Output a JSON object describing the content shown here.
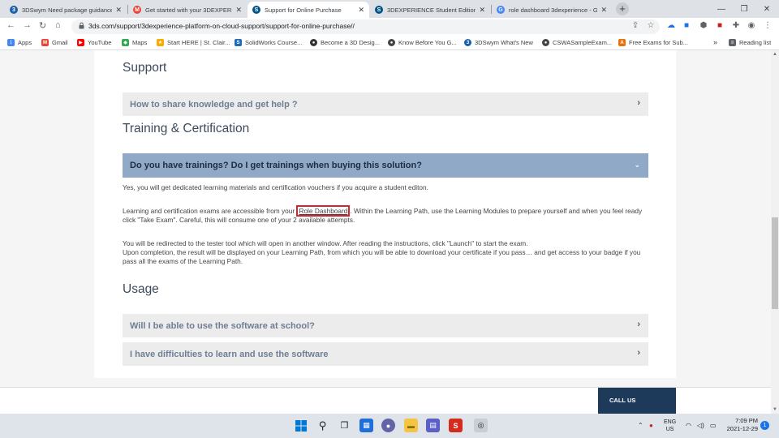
{
  "browser": {
    "tabs": [
      {
        "title": "3DSwym Need package guidance",
        "fav_color": "#1b5fa8",
        "fav_glyph": "3"
      },
      {
        "title": "Get started with your 3DEXPERIE",
        "fav_color": "#ea4335",
        "fav_glyph": "M"
      },
      {
        "title": "Support for Online Purchase",
        "fav_color": "#005386",
        "fav_glyph": "S"
      },
      {
        "title": "3DEXPERIENCE Student Editions",
        "fav_color": "#005386",
        "fav_glyph": "S"
      },
      {
        "title": "role dashboard 3dexperience - G",
        "fav_color": "#4285f4",
        "fav_glyph": "G"
      }
    ],
    "active_tab": 2,
    "new_tab": "+",
    "window_controls": {
      "minimize": "—",
      "restore": "❐",
      "close": "✕"
    },
    "url": "3ds.com/support/3dexperience-platform-on-cloud-support/support-for-online-purchase//",
    "bookmarks": [
      {
        "label": "Apps",
        "color": "#4285f4",
        "glyph": "⋮"
      },
      {
        "label": "Gmail",
        "color": "#ea4335",
        "glyph": "M"
      },
      {
        "label": "YouTube",
        "color": "#ff0000",
        "glyph": "▶"
      },
      {
        "label": "Maps",
        "color": "#34a853",
        "glyph": "◆"
      },
      {
        "label": "Start HERE | St. Clair...",
        "color": "#f9ab00",
        "glyph": "★"
      },
      {
        "label": "SolidWorks Course...",
        "color": "#1e6bb8",
        "glyph": "S"
      },
      {
        "label": "Become a 3D Desig...",
        "color": "#333333",
        "glyph": "●"
      },
      {
        "label": "Know Before You G...",
        "color": "#444444",
        "glyph": "●"
      },
      {
        "label": "3DSwym What's New",
        "color": "#1b5fa8",
        "glyph": "3"
      },
      {
        "label": "CSWASampleExam...",
        "color": "#444444",
        "glyph": "●"
      },
      {
        "label": "Free Exams for Sub...",
        "color": "#e8710a",
        "glyph": "A"
      }
    ],
    "bookmarks_more": "»",
    "reading_list": "Reading list"
  },
  "content": {
    "support_heading": "Support",
    "support_items": [
      {
        "label": "How to share knowledge and get help ?",
        "chevron": "›"
      }
    ],
    "training_heading": "Training & Certification",
    "training_item": {
      "label": "Do you have trainings? Do I get trainings when buying this solution?",
      "chevron": "⌄"
    },
    "answer": {
      "p1": "Yes, you will get dedicated learning materials and certification vouchers if you acquire a student editon.",
      "p2_before": "Learning and certification exams are accessible from your ",
      "p2_link": "Role Dashboard",
      "p2_after": ". Within the Learning Path, use the Learning Modules to prepare yourself and when you feel ready click \"Take Exam\". Careful, this will consume one of your 2 available attempts.",
      "p3_line1": "You will be redirected to the tester tool which will open in another window. After reading the instructions, click \"Launch\" to start the exam.",
      "p3_line2": "Upon completion, the result will be displayed on your Learning Path, from which you will be able to download your certificate if you pass… and get access to your badge if you pass all the exams of the Learning Path."
    },
    "usage_heading": "Usage",
    "usage_items": [
      {
        "label": "Will I be able to use the software at school?",
        "chevron": "›"
      },
      {
        "label": "I have difficulties to learn and use the software",
        "chevron": "›"
      }
    ],
    "call_us": "CALL US"
  },
  "taskbar": {
    "language": "ENG",
    "region": "US",
    "time": "7:09 PM",
    "date": "2021-12-29",
    "notifications": "1"
  }
}
